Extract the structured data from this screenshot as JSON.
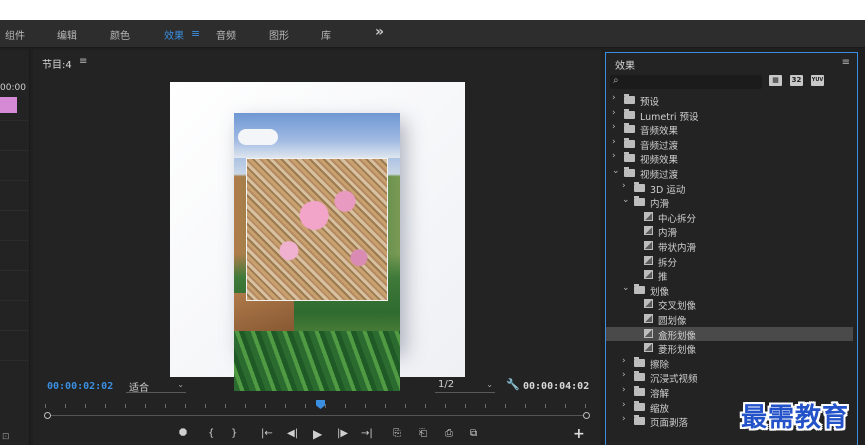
{
  "tabs": [
    {
      "label": "组件",
      "active": false
    },
    {
      "label": "编辑",
      "active": false
    },
    {
      "label": "颜色",
      "active": false
    },
    {
      "label": "效果",
      "active": true
    },
    {
      "label": "音频",
      "active": false
    },
    {
      "label": "图形",
      "active": false
    },
    {
      "label": "库",
      "active": false
    }
  ],
  "tab_menu_icon": "hamburger-icon",
  "tab_overflow": "»",
  "left_panel": {
    "timecode": "00:00"
  },
  "program": {
    "title": "节目:4",
    "menu": "≡",
    "current_timecode": "00:00:02:02",
    "fit_label": "适合",
    "resolution": "1/2",
    "duration": "00:00:04:02",
    "controls": [
      "marker-icon",
      "mark-in-icon",
      "mark-out-icon",
      "go-to-in-icon",
      "step-back-icon",
      "play-icon",
      "step-forward-icon",
      "go-to-out-icon",
      "lift-icon",
      "extract-icon",
      "export-frame-icon",
      "compare-icon",
      "add-button-icon"
    ],
    "control_glyphs": [
      "⯃",
      "{",
      "}",
      "|←",
      "◀|",
      "▶",
      "|▶",
      "→|",
      "⎘",
      "⎗",
      "⎙",
      "⧉"
    ],
    "add_glyph": "+"
  },
  "effects": {
    "title": "效果",
    "menu": "≡",
    "search_icon": "⌕",
    "tools": [
      "32",
      "YUV"
    ],
    "tree": [
      {
        "label": "预设",
        "depth": 0,
        "type": "folder-star",
        "expanded": false
      },
      {
        "label": "Lumetri 预设",
        "depth": 0,
        "type": "folder-star",
        "expanded": false
      },
      {
        "label": "音频效果",
        "depth": 0,
        "type": "folder",
        "expanded": false
      },
      {
        "label": "音频过渡",
        "depth": 0,
        "type": "folder",
        "expanded": false
      },
      {
        "label": "视频效果",
        "depth": 0,
        "type": "folder",
        "expanded": false
      },
      {
        "label": "视频过渡",
        "depth": 0,
        "type": "folder",
        "expanded": true
      },
      {
        "label": "3D 运动",
        "depth": 1,
        "type": "folder",
        "expanded": false
      },
      {
        "label": "内滑",
        "depth": 1,
        "type": "folder",
        "expanded": true
      },
      {
        "label": "中心拆分",
        "depth": 2,
        "type": "effect"
      },
      {
        "label": "内滑",
        "depth": 2,
        "type": "effect"
      },
      {
        "label": "带状内滑",
        "depth": 2,
        "type": "effect"
      },
      {
        "label": "拆分",
        "depth": 2,
        "type": "effect"
      },
      {
        "label": "推",
        "depth": 2,
        "type": "effect"
      },
      {
        "label": "划像",
        "depth": 1,
        "type": "folder",
        "expanded": true
      },
      {
        "label": "交叉划像",
        "depth": 2,
        "type": "effect"
      },
      {
        "label": "圆划像",
        "depth": 2,
        "type": "effect"
      },
      {
        "label": "盒形划像",
        "depth": 2,
        "type": "effect",
        "selected": true
      },
      {
        "label": "菱形划像",
        "depth": 2,
        "type": "effect"
      },
      {
        "label": "擦除",
        "depth": 1,
        "type": "folder",
        "expanded": false
      },
      {
        "label": "沉浸式视频",
        "depth": 1,
        "type": "folder",
        "expanded": false
      },
      {
        "label": "溶解",
        "depth": 1,
        "type": "folder",
        "expanded": false
      },
      {
        "label": "缩放",
        "depth": 1,
        "type": "folder",
        "expanded": false
      },
      {
        "label": "页面剥落",
        "depth": 1,
        "type": "folder",
        "expanded": false
      }
    ]
  },
  "watermark": "最需教育",
  "colors": {
    "accent": "#3b8fe0",
    "panel": "#232323",
    "watermark": "#2453c9"
  }
}
